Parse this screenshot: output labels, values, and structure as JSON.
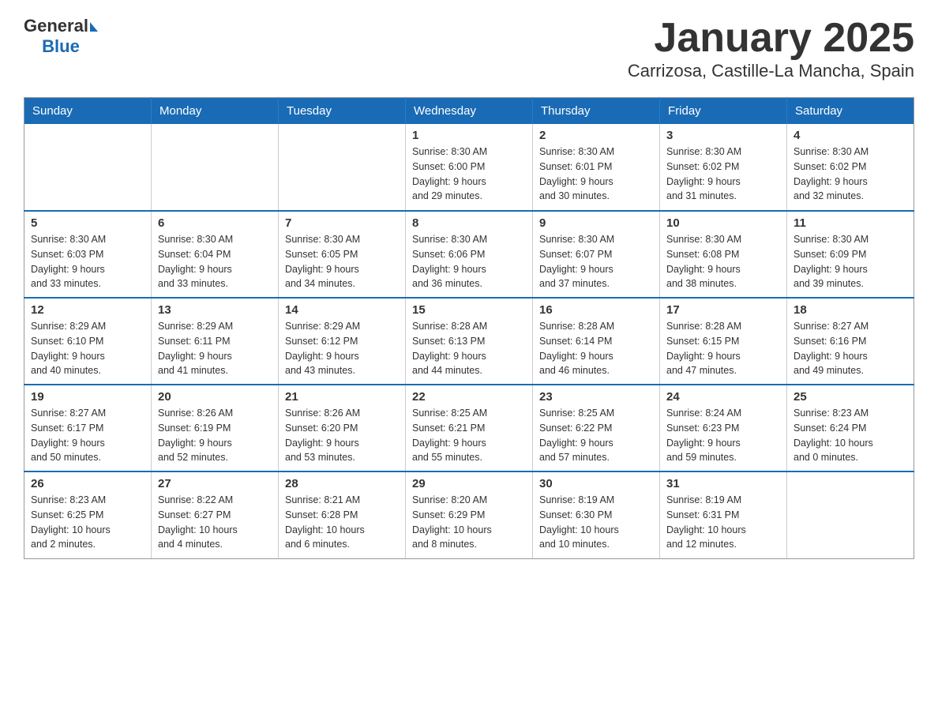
{
  "header": {
    "logo_general": "General",
    "logo_blue": "Blue",
    "month_title": "January 2025",
    "location": "Carrizosa, Castille-La Mancha, Spain"
  },
  "weekdays": [
    "Sunday",
    "Monday",
    "Tuesday",
    "Wednesday",
    "Thursday",
    "Friday",
    "Saturday"
  ],
  "weeks": [
    [
      {
        "day": "",
        "info": ""
      },
      {
        "day": "",
        "info": ""
      },
      {
        "day": "",
        "info": ""
      },
      {
        "day": "1",
        "info": "Sunrise: 8:30 AM\nSunset: 6:00 PM\nDaylight: 9 hours\nand 29 minutes."
      },
      {
        "day": "2",
        "info": "Sunrise: 8:30 AM\nSunset: 6:01 PM\nDaylight: 9 hours\nand 30 minutes."
      },
      {
        "day": "3",
        "info": "Sunrise: 8:30 AM\nSunset: 6:02 PM\nDaylight: 9 hours\nand 31 minutes."
      },
      {
        "day": "4",
        "info": "Sunrise: 8:30 AM\nSunset: 6:02 PM\nDaylight: 9 hours\nand 32 minutes."
      }
    ],
    [
      {
        "day": "5",
        "info": "Sunrise: 8:30 AM\nSunset: 6:03 PM\nDaylight: 9 hours\nand 33 minutes."
      },
      {
        "day": "6",
        "info": "Sunrise: 8:30 AM\nSunset: 6:04 PM\nDaylight: 9 hours\nand 33 minutes."
      },
      {
        "day": "7",
        "info": "Sunrise: 8:30 AM\nSunset: 6:05 PM\nDaylight: 9 hours\nand 34 minutes."
      },
      {
        "day": "8",
        "info": "Sunrise: 8:30 AM\nSunset: 6:06 PM\nDaylight: 9 hours\nand 36 minutes."
      },
      {
        "day": "9",
        "info": "Sunrise: 8:30 AM\nSunset: 6:07 PM\nDaylight: 9 hours\nand 37 minutes."
      },
      {
        "day": "10",
        "info": "Sunrise: 8:30 AM\nSunset: 6:08 PM\nDaylight: 9 hours\nand 38 minutes."
      },
      {
        "day": "11",
        "info": "Sunrise: 8:30 AM\nSunset: 6:09 PM\nDaylight: 9 hours\nand 39 minutes."
      }
    ],
    [
      {
        "day": "12",
        "info": "Sunrise: 8:29 AM\nSunset: 6:10 PM\nDaylight: 9 hours\nand 40 minutes."
      },
      {
        "day": "13",
        "info": "Sunrise: 8:29 AM\nSunset: 6:11 PM\nDaylight: 9 hours\nand 41 minutes."
      },
      {
        "day": "14",
        "info": "Sunrise: 8:29 AM\nSunset: 6:12 PM\nDaylight: 9 hours\nand 43 minutes."
      },
      {
        "day": "15",
        "info": "Sunrise: 8:28 AM\nSunset: 6:13 PM\nDaylight: 9 hours\nand 44 minutes."
      },
      {
        "day": "16",
        "info": "Sunrise: 8:28 AM\nSunset: 6:14 PM\nDaylight: 9 hours\nand 46 minutes."
      },
      {
        "day": "17",
        "info": "Sunrise: 8:28 AM\nSunset: 6:15 PM\nDaylight: 9 hours\nand 47 minutes."
      },
      {
        "day": "18",
        "info": "Sunrise: 8:27 AM\nSunset: 6:16 PM\nDaylight: 9 hours\nand 49 minutes."
      }
    ],
    [
      {
        "day": "19",
        "info": "Sunrise: 8:27 AM\nSunset: 6:17 PM\nDaylight: 9 hours\nand 50 minutes."
      },
      {
        "day": "20",
        "info": "Sunrise: 8:26 AM\nSunset: 6:19 PM\nDaylight: 9 hours\nand 52 minutes."
      },
      {
        "day": "21",
        "info": "Sunrise: 8:26 AM\nSunset: 6:20 PM\nDaylight: 9 hours\nand 53 minutes."
      },
      {
        "day": "22",
        "info": "Sunrise: 8:25 AM\nSunset: 6:21 PM\nDaylight: 9 hours\nand 55 minutes."
      },
      {
        "day": "23",
        "info": "Sunrise: 8:25 AM\nSunset: 6:22 PM\nDaylight: 9 hours\nand 57 minutes."
      },
      {
        "day": "24",
        "info": "Sunrise: 8:24 AM\nSunset: 6:23 PM\nDaylight: 9 hours\nand 59 minutes."
      },
      {
        "day": "25",
        "info": "Sunrise: 8:23 AM\nSunset: 6:24 PM\nDaylight: 10 hours\nand 0 minutes."
      }
    ],
    [
      {
        "day": "26",
        "info": "Sunrise: 8:23 AM\nSunset: 6:25 PM\nDaylight: 10 hours\nand 2 minutes."
      },
      {
        "day": "27",
        "info": "Sunrise: 8:22 AM\nSunset: 6:27 PM\nDaylight: 10 hours\nand 4 minutes."
      },
      {
        "day": "28",
        "info": "Sunrise: 8:21 AM\nSunset: 6:28 PM\nDaylight: 10 hours\nand 6 minutes."
      },
      {
        "day": "29",
        "info": "Sunrise: 8:20 AM\nSunset: 6:29 PM\nDaylight: 10 hours\nand 8 minutes."
      },
      {
        "day": "30",
        "info": "Sunrise: 8:19 AM\nSunset: 6:30 PM\nDaylight: 10 hours\nand 10 minutes."
      },
      {
        "day": "31",
        "info": "Sunrise: 8:19 AM\nSunset: 6:31 PM\nDaylight: 10 hours\nand 12 minutes."
      },
      {
        "day": "",
        "info": ""
      }
    ]
  ]
}
